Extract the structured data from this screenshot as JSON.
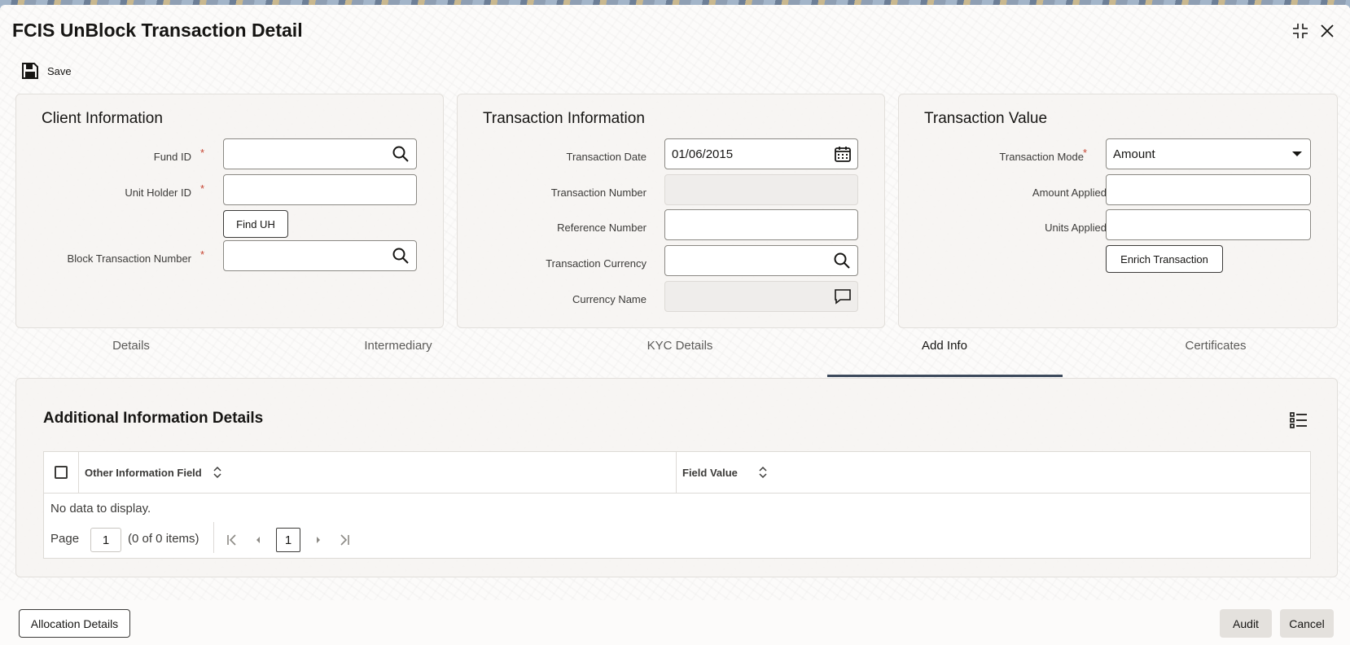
{
  "window": {
    "title": "FCIS UnBlock Transaction Detail",
    "icons": [
      "maximize-icon",
      "close-icon"
    ]
  },
  "toolbar": {
    "save_label": "Save",
    "save_icon": "save-icon"
  },
  "client_info": {
    "title": "Client Information",
    "fund_id_label": "Fund ID",
    "fund_id_value": "",
    "unit_holder_label": "Unit Holder ID",
    "unit_holder_value": "",
    "find_uh_label": "Find UH",
    "block_txn_label": "Block Transaction Number",
    "block_txn_value": "",
    "required_mark": "*"
  },
  "txn_info": {
    "title": "Transaction Information",
    "date_label": "Transaction Date",
    "date_value": "01/06/2015",
    "number_label": "Transaction Number",
    "number_value": "",
    "reference_label": "Reference Number",
    "reference_value": "",
    "currency_label": "Transaction Currency",
    "currency_value": "",
    "currency_name_label": "Currency Name",
    "currency_name_value": ""
  },
  "txn_value": {
    "title": "Transaction Value",
    "mode_label": "Transaction Mode",
    "mode_value": "Amount",
    "amount_label": "Amount Applied",
    "amount_value": "",
    "units_label": "Units Applied",
    "units_value": "",
    "enrich_label": "Enrich Transaction"
  },
  "tabs": [
    {
      "label": "Details",
      "active": false
    },
    {
      "label": "Intermediary",
      "active": false
    },
    {
      "label": "KYC Details",
      "active": false
    },
    {
      "label": "Add Info",
      "active": true
    },
    {
      "label": "Certificates",
      "active": false
    }
  ],
  "add_info": {
    "title": "Additional Information Details",
    "columns": [
      "Other Information Field",
      "Field Value"
    ],
    "empty_text": "No data to display.",
    "pager": {
      "page_label": "Page",
      "page_value": "1",
      "items_text": "(0 of 0 items)",
      "current_page": "1"
    }
  },
  "footer": {
    "allocation_label": "Allocation Details",
    "audit_label": "Audit",
    "cancel_label": "Cancel"
  },
  "colors": {
    "required": "#c74634",
    "tab_active_underline": "#3d4a5c",
    "background": "#fcfbfa"
  }
}
